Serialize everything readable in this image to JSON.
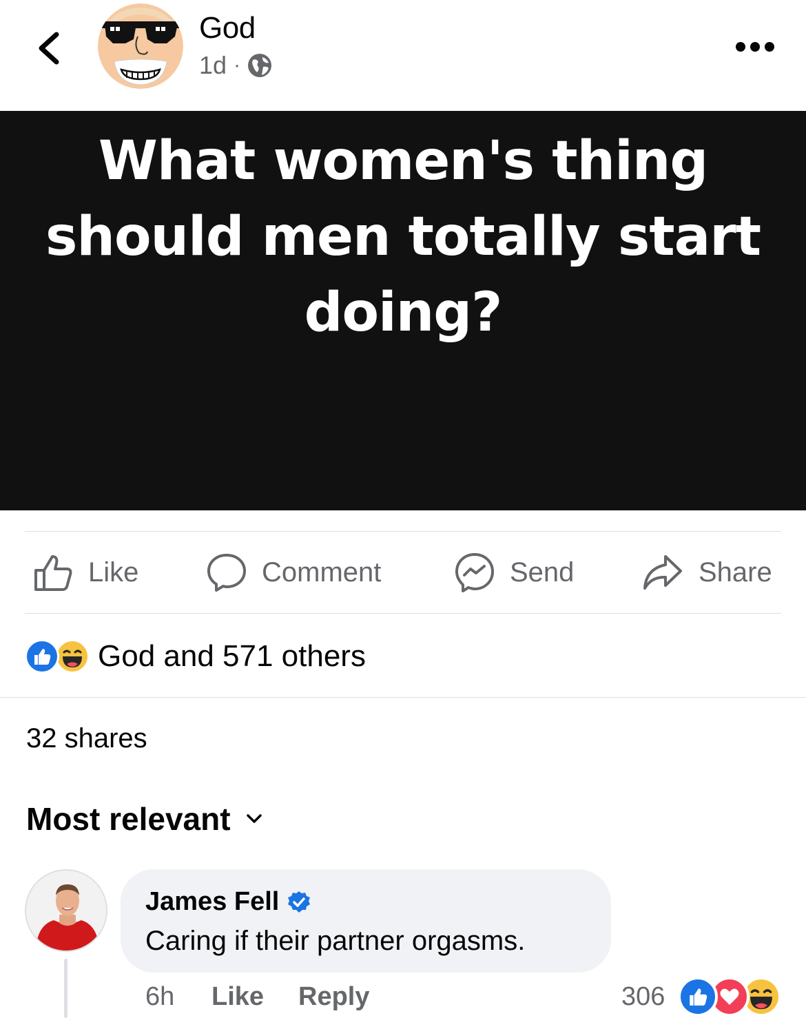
{
  "post": {
    "author": "God",
    "time": "1d",
    "separator": "·",
    "audience_icon": "globe-icon",
    "text": "What women's thing should men totally start doing?"
  },
  "actions": {
    "like": "Like",
    "comment": "Comment",
    "send": "Send",
    "share": "Share"
  },
  "reactions_summary": {
    "text": "God and 571 others",
    "icons": [
      "like-reaction-icon",
      "haha-reaction-icon"
    ]
  },
  "shares_text": "32 shares",
  "comments_sort": "Most relevant",
  "comment": {
    "author": "James Fell",
    "verified": true,
    "text": "Caring if their partner orgasms.",
    "time": "6h",
    "like_label": "Like",
    "reply_label": "Reply",
    "reaction_count": "306",
    "reaction_icons": [
      "like-reaction-icon",
      "love-reaction-icon",
      "haha-reaction-icon"
    ]
  },
  "colors": {
    "post_background": "#111111",
    "secondary_text": "#65676b",
    "facebook_blue": "#1b74e4",
    "love_red": "#f33e58",
    "haha_yellow": "#f7c23e",
    "bubble_background": "#f0f2f5"
  }
}
